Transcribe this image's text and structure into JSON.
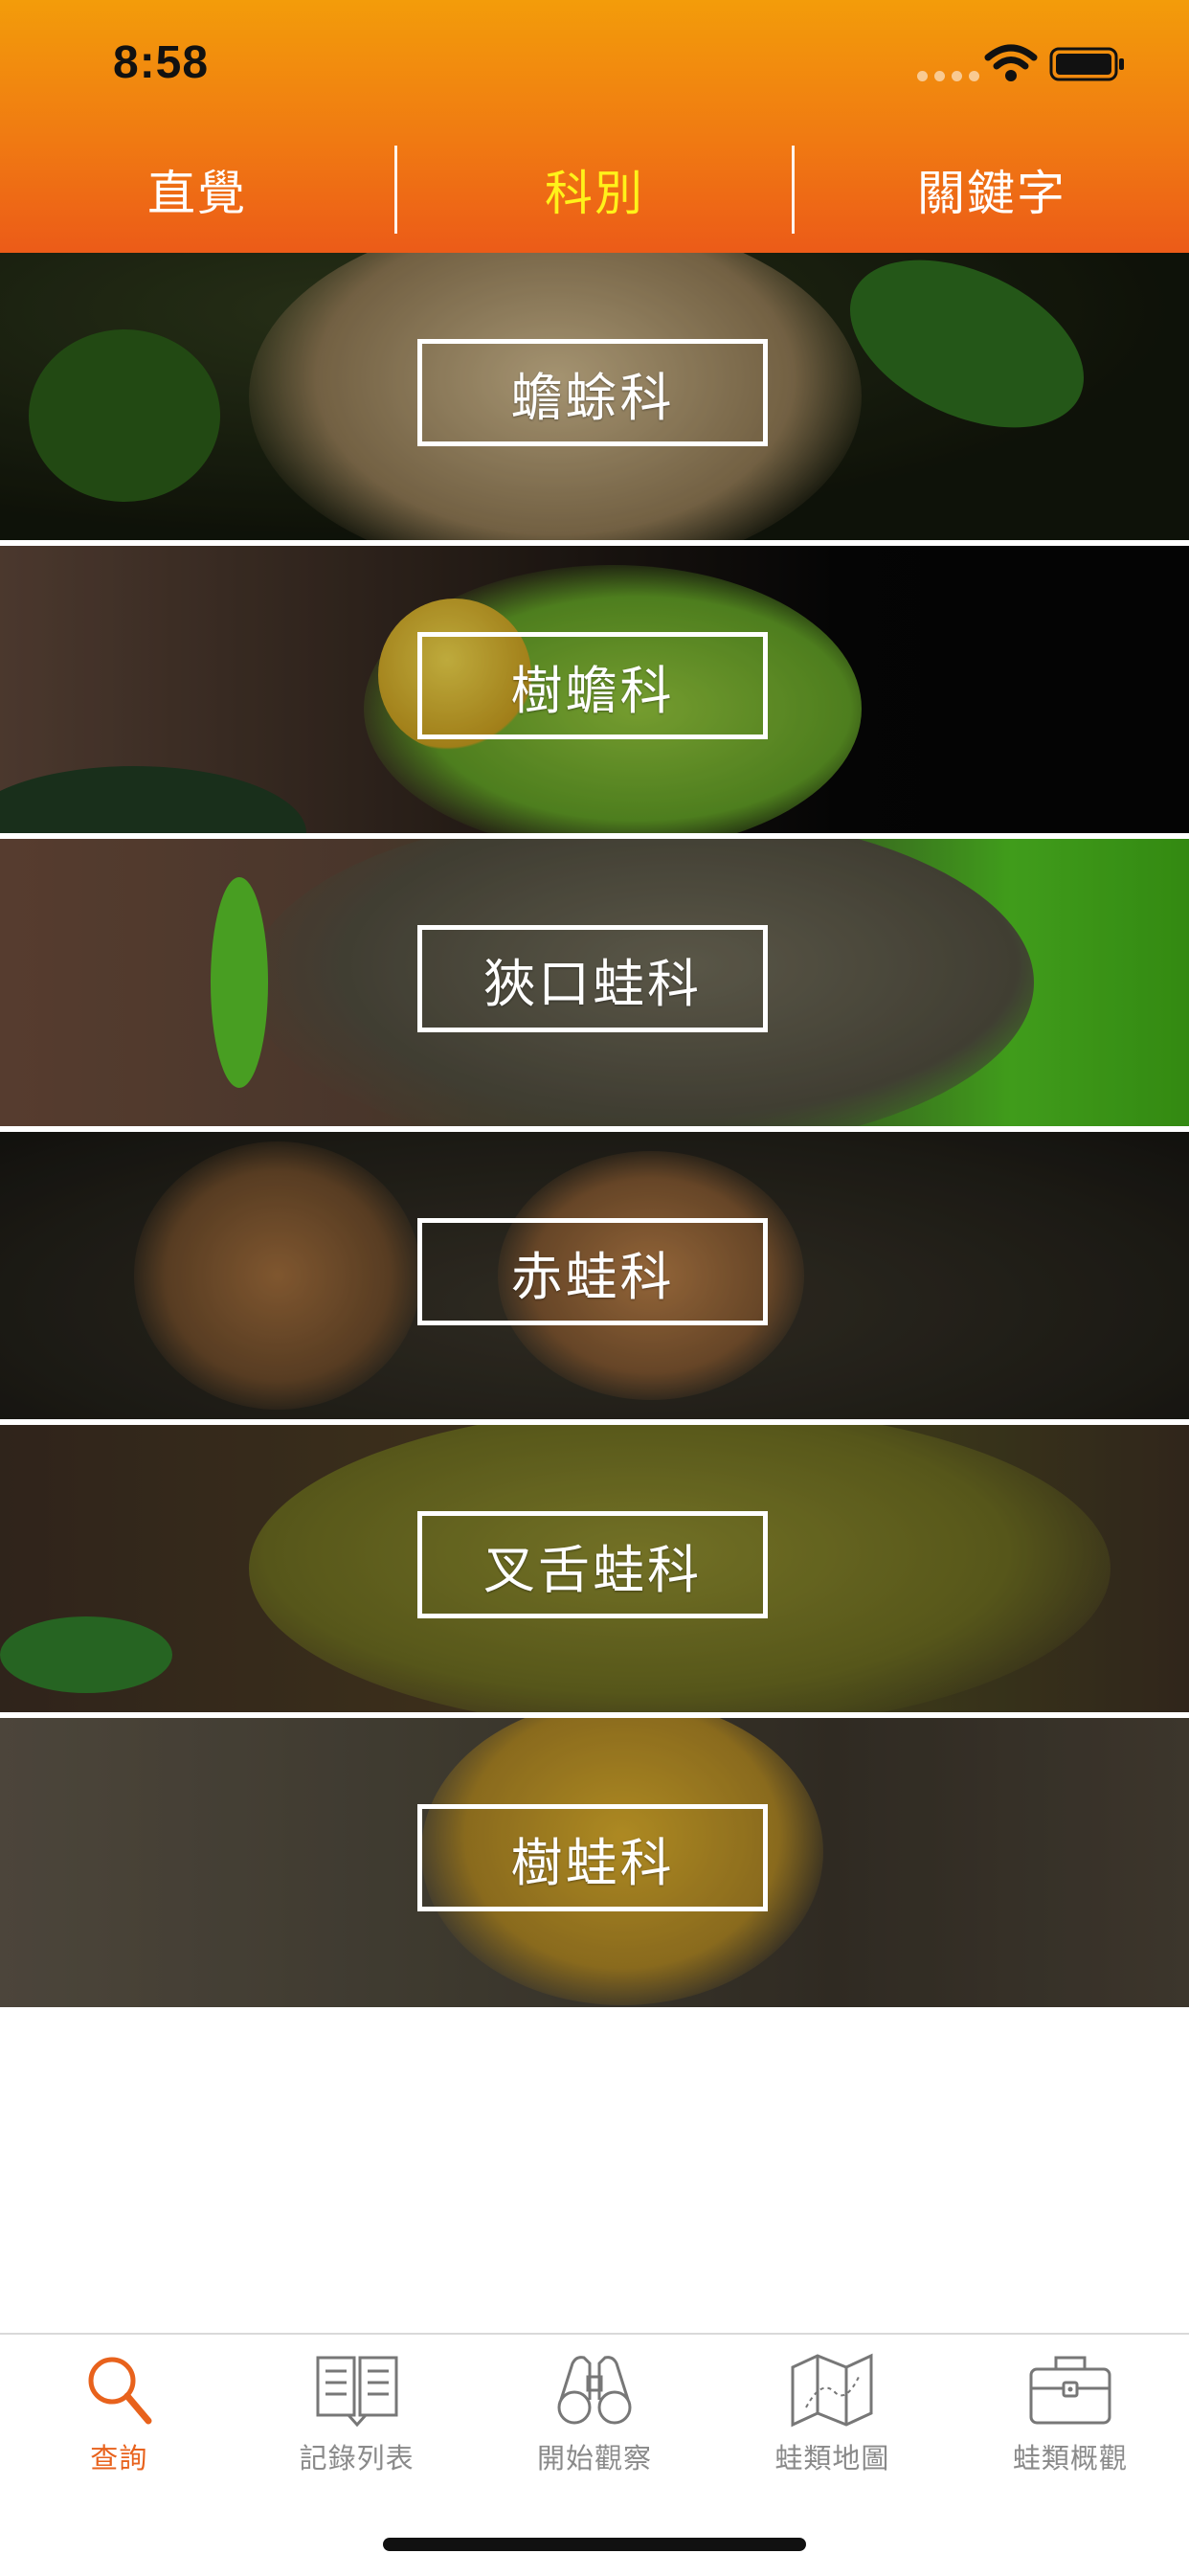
{
  "status_bar": {
    "time": "8:58"
  },
  "segments": {
    "items": [
      {
        "label": "直覺"
      },
      {
        "label": "科別"
      },
      {
        "label": "關鍵字"
      }
    ],
    "active_label": "科別"
  },
  "families": [
    {
      "label": "蟾蜍科",
      "palette": "toad"
    },
    {
      "label": "樹蟾科",
      "palette": "treetoad"
    },
    {
      "label": "狹口蛙科",
      "palette": "narrowmouth"
    },
    {
      "label": "赤蛙科",
      "palette": "truefrog"
    },
    {
      "label": "叉舌蛙科",
      "palette": "forktongue"
    },
    {
      "label": "樹蛙科",
      "palette": "treefrog"
    }
  ],
  "tabbar": {
    "items": [
      {
        "label": "查詢",
        "icon": "search-icon"
      },
      {
        "label": "記錄列表",
        "icon": "book-icon"
      },
      {
        "label": "開始觀察",
        "icon": "binoculars-icon"
      },
      {
        "label": "蛙類地圖",
        "icon": "map-icon"
      },
      {
        "label": "蛙類概觀",
        "icon": "toolbox-icon"
      }
    ],
    "active_label": "查詢"
  },
  "colors": {
    "header_top": "#f39c0a",
    "header_bottom": "#ec5b18",
    "active_segment": "#fff21a",
    "active_tab": "#e8621c",
    "inactive_tab": "#8a8a8a"
  }
}
